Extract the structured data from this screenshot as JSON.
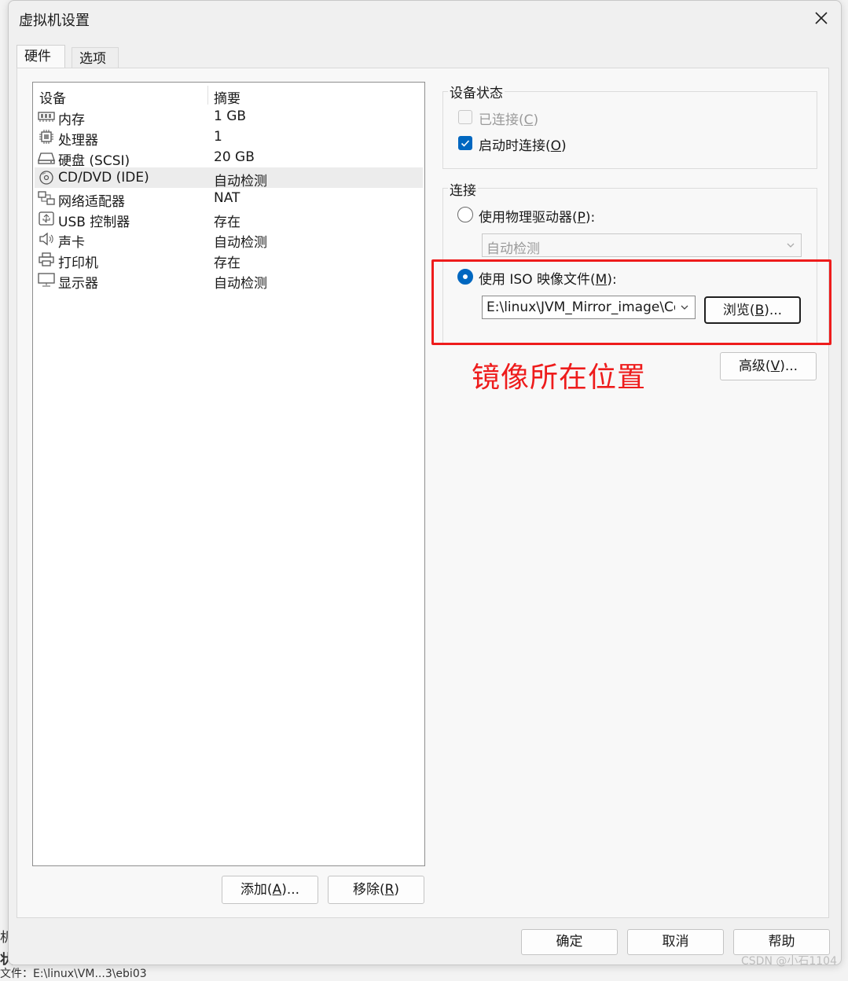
{
  "window": {
    "title": "虚拟机设置"
  },
  "tabs": [
    {
      "label": "硬件"
    },
    {
      "label": "选项"
    }
  ],
  "device_list": {
    "header": {
      "device": "设备",
      "summary": "摘要"
    },
    "rows": [
      {
        "icon": "memory-icon",
        "name": "内存",
        "summary": "1 GB"
      },
      {
        "icon": "cpu-icon",
        "name": "处理器",
        "summary": "1"
      },
      {
        "icon": "hard-disk-icon",
        "name": "硬盘 (SCSI)",
        "summary": "20 GB"
      },
      {
        "icon": "cd-dvd-icon",
        "name": "CD/DVD (IDE)",
        "summary": "自动检测",
        "selected": true
      },
      {
        "icon": "network-adapter-icon",
        "name": "网络适配器",
        "summary": "NAT"
      },
      {
        "icon": "usb-icon",
        "name": "USB 控制器",
        "summary": "存在"
      },
      {
        "icon": "speaker-icon",
        "name": "声卡",
        "summary": "自动检测"
      },
      {
        "icon": "printer-icon",
        "name": "打印机",
        "summary": "存在"
      },
      {
        "icon": "monitor-icon",
        "name": "显示器",
        "summary": "自动检测"
      }
    ]
  },
  "list_buttons": {
    "add": {
      "label": "添加(",
      "key": "A",
      "suffix": ")..."
    },
    "remove": {
      "label": "移除(",
      "key": "R",
      "suffix": ")"
    }
  },
  "device_status": {
    "legend": "设备状态",
    "connected": {
      "label": "已连接(",
      "key": "C",
      "suffix": ")",
      "checked": false,
      "disabled": true
    },
    "connect_at_power_on": {
      "label": "启动时连接(",
      "key": "O",
      "suffix": ")",
      "checked": true
    }
  },
  "connection": {
    "legend": "连接",
    "physical_drive": {
      "label": "使用物理驱动器(",
      "key": "P",
      "suffix": "):",
      "selected": false,
      "value": "自动检测"
    },
    "iso_image": {
      "label": "使用 ISO 映像文件(",
      "key": "M",
      "suffix": "):",
      "selected": true,
      "value": "E:\\linux\\JVM_Mirror_image\\Ce"
    },
    "browse": {
      "label": "浏览(",
      "key": "B",
      "suffix": ")..."
    }
  },
  "advanced": {
    "label": "高级(",
    "key": "V",
    "suffix": ")..."
  },
  "annotation": {
    "text": "镜像所在位置",
    "color": "#ee1c1c"
  },
  "footer": {
    "ok": "确定",
    "cancel": "取消",
    "help": "帮助"
  },
  "background_window": {
    "line1": "机",
    "line2": "状",
    "line3": "文件：E:\\linux\\VM...3\\ebi03"
  },
  "watermark": "CSDN @小石1104",
  "colors": {
    "accent": "#0067c0",
    "annotation": "#ee1c1c"
  }
}
